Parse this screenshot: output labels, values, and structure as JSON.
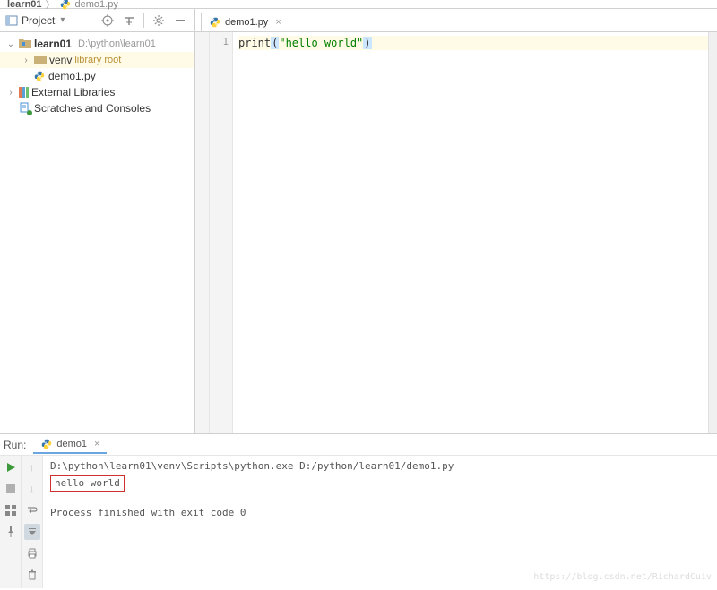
{
  "breadcrumb": {
    "root": "learn01",
    "file": "demo1.py"
  },
  "project_panel": {
    "title": "Project"
  },
  "tree": {
    "root_name": "learn01",
    "root_path": "D:\\python\\learn01",
    "venv_name": "venv",
    "venv_hint": "library root",
    "file_name": "demo1.py",
    "ext_lib": "External Libraries",
    "scratches": "Scratches and Consoles"
  },
  "editor": {
    "tab_name": "demo1.py",
    "line_number": "1",
    "code_fn": "print",
    "code_str": "\"hello world\""
  },
  "run": {
    "label": "Run:",
    "tab_name": "demo1",
    "cmd": "D:\\python\\learn01\\venv\\Scripts\\python.exe D:/python/learn01/demo1.py",
    "output": "hello world",
    "exit_msg": "Process finished with exit code 0"
  },
  "watermark": "https://blog.csdn.net/RichardCuiv"
}
